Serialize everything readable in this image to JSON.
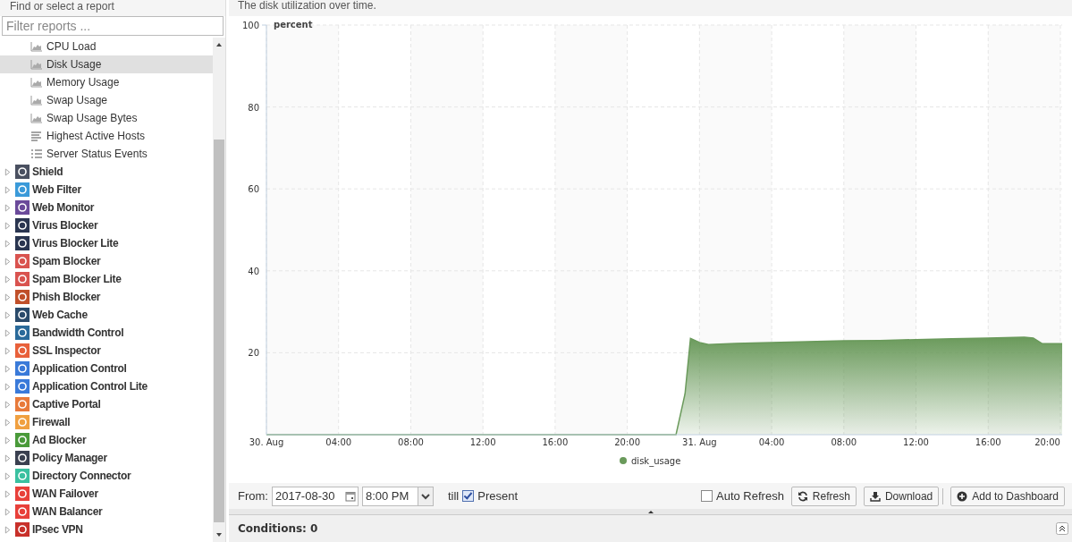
{
  "sidebar": {
    "title": "Find or select a report",
    "filter": {
      "placeholder": "Filter reports ..."
    },
    "reports": [
      {
        "label": "CPU Load",
        "kind": "area",
        "selected": false
      },
      {
        "label": "Disk Usage",
        "kind": "area",
        "selected": true
      },
      {
        "label": "Memory Usage",
        "kind": "area",
        "selected": false
      },
      {
        "label": "Swap Usage",
        "kind": "area",
        "selected": false
      },
      {
        "label": "Swap Usage Bytes",
        "kind": "area",
        "selected": false
      },
      {
        "label": "Highest Active Hosts",
        "kind": "bars",
        "selected": false
      },
      {
        "label": "Server Status Events",
        "kind": "list",
        "selected": false
      }
    ],
    "apps": [
      {
        "label": "Shield",
        "color": "#4a5060",
        "expanded": false
      },
      {
        "label": "Web Filter",
        "color": "#3a9ad9",
        "expanded": false
      },
      {
        "label": "Web Monitor",
        "color": "#6a4a9a",
        "expanded": false
      },
      {
        "label": "Virus Blocker",
        "color": "#2a3550",
        "expanded": false
      },
      {
        "label": "Virus Blocker Lite",
        "color": "#2a3550",
        "expanded": false
      },
      {
        "label": "Spam Blocker",
        "color": "#d9534f",
        "expanded": false
      },
      {
        "label": "Spam Blocker Lite",
        "color": "#d9534f",
        "expanded": false
      },
      {
        "label": "Phish Blocker",
        "color": "#c0502a",
        "expanded": false
      },
      {
        "label": "Web Cache",
        "color": "#2a4a6a",
        "expanded": false
      },
      {
        "label": "Bandwidth Control",
        "color": "#2a6a9a",
        "expanded": false
      },
      {
        "label": "SSL Inspector",
        "color": "#e8603a",
        "expanded": false
      },
      {
        "label": "Application Control",
        "color": "#3a7ad9",
        "expanded": false
      },
      {
        "label": "Application Control Lite",
        "color": "#3a7ad9",
        "expanded": false
      },
      {
        "label": "Captive Portal",
        "color": "#e87a3a",
        "expanded": false
      },
      {
        "label": "Firewall",
        "color": "#f0a040",
        "expanded": false
      },
      {
        "label": "Ad Blocker",
        "color": "#4a9a3a",
        "expanded": false
      },
      {
        "label": "Policy Manager",
        "color": "#3a4050",
        "expanded": false
      },
      {
        "label": "Directory Connector",
        "color": "#3ac0a0",
        "expanded": false
      },
      {
        "label": "WAN Failover",
        "color": "#e8403a",
        "expanded": false
      },
      {
        "label": "WAN Balancer",
        "color": "#e8403a",
        "expanded": false
      },
      {
        "label": "IPsec VPN",
        "color": "#c8302a",
        "expanded": false
      }
    ]
  },
  "report": {
    "description": "The disk utilization over time.",
    "chart_data": {
      "type": "area",
      "grid": true,
      "ylabel": "percent",
      "xlim": [
        "2017-08-30T00:00",
        "2017-08-31T20:06"
      ],
      "ylim": [
        0,
        100
      ],
      "x": [
        "2017-08-30T00:00",
        "2017-08-30T04:00",
        "2017-08-30T08:00",
        "2017-08-30T12:00",
        "2017-08-30T16:00",
        "2017-08-30T20:00",
        "2017-08-30T22:00",
        "2017-08-30T22:42",
        "2017-08-30T23:12",
        "2017-08-30T23:30",
        "2017-08-31T00:00",
        "2017-08-31T00:30",
        "2017-08-31T02:00",
        "2017-08-31T04:00",
        "2017-08-31T06:00",
        "2017-08-31T08:00",
        "2017-08-31T10:00",
        "2017-08-31T12:00",
        "2017-08-31T14:00",
        "2017-08-31T16:00",
        "2017-08-31T17:00",
        "2017-08-31T18:00",
        "2017-08-31T18:30",
        "2017-08-31T19:00",
        "2017-08-31T20:06"
      ],
      "series": [
        {
          "name": "disk_usage",
          "color": "#6a9a5b",
          "values": [
            0,
            0,
            0,
            0,
            0,
            0,
            0,
            0,
            10,
            23.5,
            22.5,
            22,
            22.3,
            22.5,
            22.7,
            22.9,
            23,
            23.2,
            23.4,
            23.6,
            23.7,
            23.8,
            23.6,
            22.2,
            22.2
          ]
        }
      ],
      "xticks": [
        {
          "value": "2017-08-30T00:00",
          "label": "30. Aug"
        },
        {
          "value": "2017-08-30T04:00",
          "label": "04:00"
        },
        {
          "value": "2017-08-30T08:00",
          "label": "08:00"
        },
        {
          "value": "2017-08-30T12:00",
          "label": "12:00"
        },
        {
          "value": "2017-08-30T16:00",
          "label": "16:00"
        },
        {
          "value": "2017-08-30T20:00",
          "label": "20:00"
        },
        {
          "value": "2017-08-31T00:00",
          "label": "31. Aug"
        },
        {
          "value": "2017-08-31T04:00",
          "label": "04:00"
        },
        {
          "value": "2017-08-31T08:00",
          "label": "08:00"
        },
        {
          "value": "2017-08-31T12:00",
          "label": "12:00"
        },
        {
          "value": "2017-08-31T16:00",
          "label": "16:00"
        },
        {
          "value": "2017-08-31T20:00",
          "label": "20:00"
        }
      ],
      "yticks": [
        20,
        40,
        60,
        80,
        100
      ]
    }
  },
  "toolbar": {
    "from_label": "From:",
    "date": "2017-08-30",
    "time": "8:00 PM",
    "till_label": "till",
    "present": {
      "label": "Present",
      "checked": true
    },
    "auto_refresh": {
      "label": "Auto Refresh",
      "checked": false
    },
    "buttons": [
      {
        "label": "Refresh",
        "kind": "refresh"
      },
      {
        "label": "Download",
        "kind": "download"
      },
      {
        "label": "Add to Dashboard",
        "kind": "add"
      }
    ]
  },
  "conditions": {
    "title": "Conditions: 0"
  }
}
